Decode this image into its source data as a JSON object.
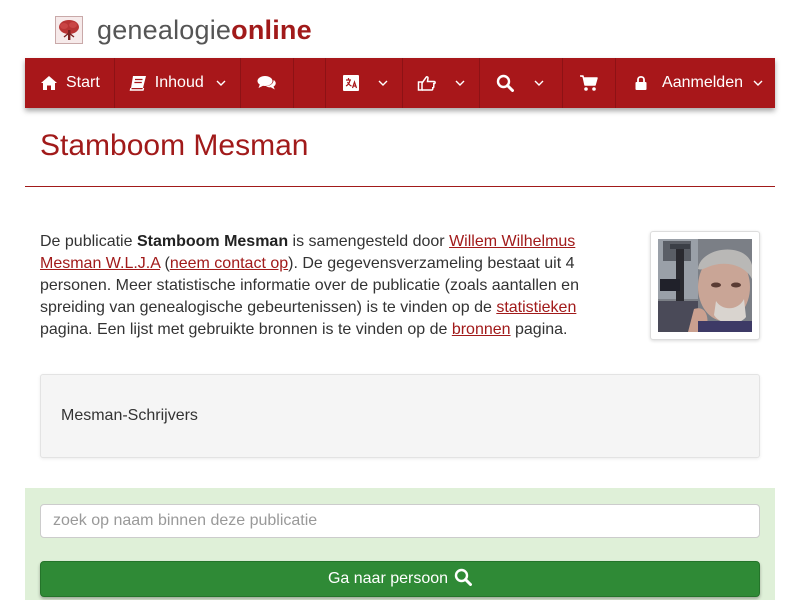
{
  "logo": {
    "part1": "genealogie",
    "part2": "online",
    "icon": "tree-icon"
  },
  "nav": {
    "start_label": "Start",
    "inhoud_label": "Inhoud",
    "aanmelden_label": "Aanmelden",
    "icons": [
      "home-icon",
      "book-icon",
      "comments-icon",
      "language-icon",
      "thumbs-up-icon",
      "search-icon",
      "cart-icon",
      "lock-icon",
      "chevron-down-icon"
    ]
  },
  "page": {
    "title": "Stamboom Mesman"
  },
  "intro": {
    "t1": "De publicatie ",
    "pub_name": "Stamboom Mesman",
    "t2": " is samengesteld door ",
    "author": "Willem Wilhelmus Mesman W.L.J.A",
    "t3": " (",
    "contact": "neem contact op",
    "t4": "). De gegevensverzameling bestaat uit 4 personen. Meer statistische informatie over de publicatie (zoals aantallen en spreiding van genealogische gebeurtenissen) is te vinden op de ",
    "stats": "statistieken",
    "t5": " pagina. Een lijst met gebruikte bronnen is te vinden op de ",
    "sources": "bronnen",
    "t6": " pagina."
  },
  "info": {
    "text": "Mesman-Schrijvers"
  },
  "search": {
    "placeholder": "zoek op naam binnen deze publicatie",
    "button_label": "Ga naar persoon"
  },
  "colors": {
    "brand": "#a8171a",
    "title": "#a11a1a",
    "search_bg": "#dff0d8",
    "button": "#2f8a36"
  }
}
